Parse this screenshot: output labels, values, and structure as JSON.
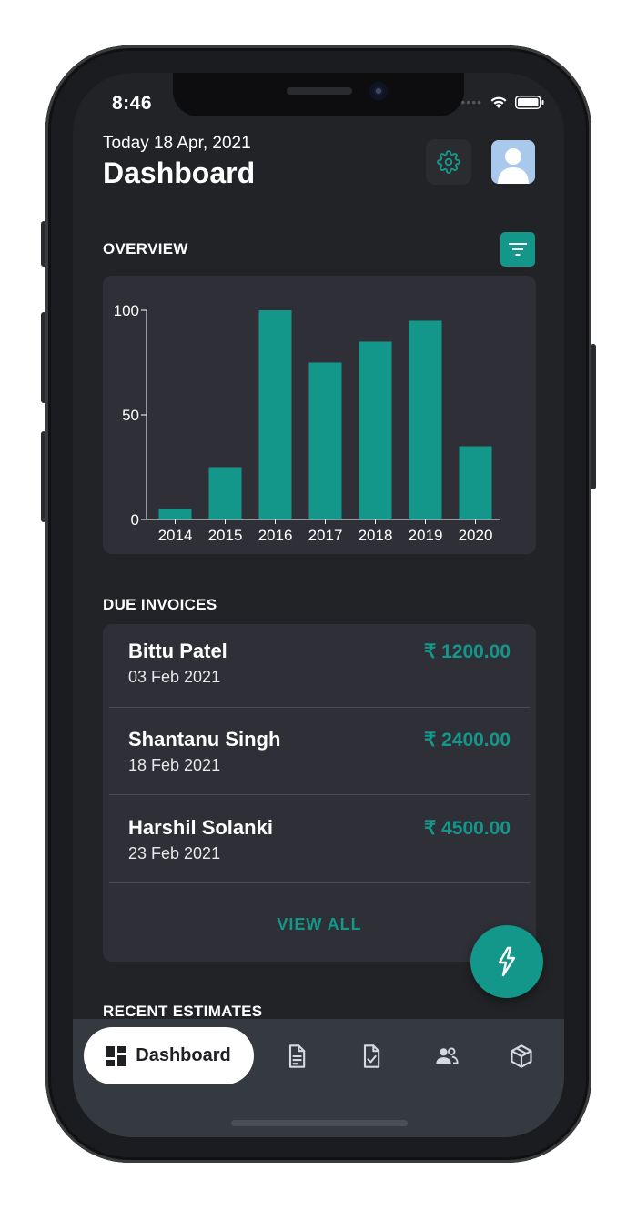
{
  "status_bar": {
    "time": "8:46"
  },
  "header": {
    "date": "Today 18 Apr, 2021",
    "title": "Dashboard",
    "settings_icon": "gear-icon",
    "avatar_icon": "user-avatar-icon"
  },
  "overview": {
    "title": "OVERVIEW",
    "filter_icon": "filter-icon"
  },
  "chart_data": {
    "type": "bar",
    "categories": [
      "2014",
      "2015",
      "2016",
      "2017",
      "2018",
      "2019",
      "2020"
    ],
    "values": [
      5,
      25,
      100,
      75,
      85,
      95,
      35
    ],
    "yticks": [
      "0",
      "50",
      "100"
    ],
    "ylim": [
      0,
      100
    ],
    "color": "#13978a",
    "grid": false
  },
  "due_invoices": {
    "title": "DUE INVOICES",
    "items": [
      {
        "name": "Bittu Patel",
        "date": "03 Feb 2021",
        "amount": "₹ 1200.00"
      },
      {
        "name": "Shantanu Singh",
        "date": "18 Feb 2021",
        "amount": "₹ 2400.00"
      },
      {
        "name": "Harshil Solanki",
        "date": "23 Feb 2021",
        "amount": "₹ 4500.00"
      }
    ],
    "view_all": "VIEW ALL"
  },
  "recent_estimates": {
    "title": "RECENT ESTIMATES"
  },
  "fab": {
    "icon": "flash-icon"
  },
  "bottom_nav": {
    "active_label": "Dashboard",
    "items": [
      "dashboard-icon",
      "invoice-icon",
      "estimate-icon",
      "customers-icon",
      "items-icon"
    ]
  },
  "colors": {
    "accent": "#13978a",
    "background": "#222326",
    "card": "#2f3037"
  }
}
